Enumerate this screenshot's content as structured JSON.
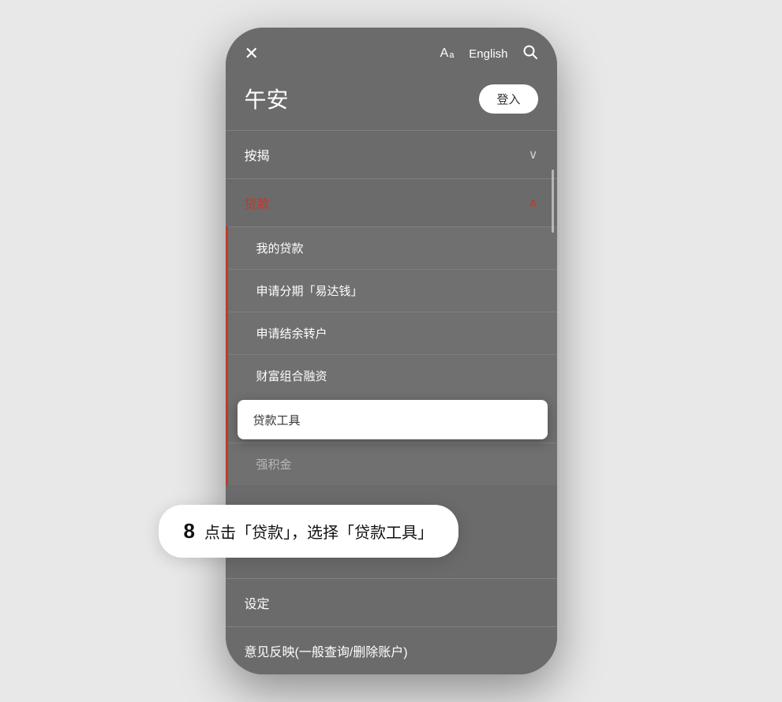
{
  "header": {
    "close_label": "✕",
    "font_size_label": "Aₐ",
    "language_label": "English",
    "search_label": "🔍"
  },
  "greeting": {
    "text": "午安",
    "login_label": "登入"
  },
  "menu": {
    "items": [
      {
        "label": "按揭",
        "expanded": false
      },
      {
        "label": "贷款",
        "expanded": true,
        "active": true
      }
    ],
    "submenu_items": [
      {
        "label": "我的贷款",
        "highlighted": false,
        "dimmed": false
      },
      {
        "label": "申请分期「易达钱」",
        "highlighted": false,
        "dimmed": false
      },
      {
        "label": "申请结余转户",
        "highlighted": false,
        "dimmed": false
      },
      {
        "label": "财富组合融资",
        "highlighted": false,
        "dimmed": false
      },
      {
        "label": "贷款工具",
        "highlighted": true,
        "dimmed": false
      },
      {
        "label": "强积金",
        "highlighted": false,
        "dimmed": true
      }
    ]
  },
  "bottom_menu": {
    "items": [
      {
        "label": "设定"
      },
      {
        "label": "意见反映(一般查询/删除账户)"
      }
    ]
  },
  "step": {
    "number": "8",
    "text": "点击「贷款」，选择「贷款工具」"
  }
}
